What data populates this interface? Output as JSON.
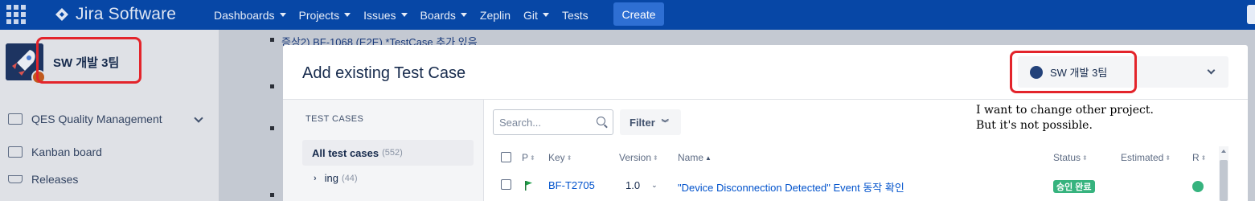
{
  "nav": {
    "logo_text": "Jira Software",
    "items": [
      {
        "label": "Dashboards",
        "has_caret": true
      },
      {
        "label": "Projects",
        "has_caret": true
      },
      {
        "label": "Issues",
        "has_caret": true
      },
      {
        "label": "Boards",
        "has_caret": true
      },
      {
        "label": "Zeplin",
        "has_caret": false
      },
      {
        "label": "Git",
        "has_caret": true
      },
      {
        "label": "Tests",
        "has_caret": false
      }
    ],
    "create_label": "Create",
    "bg_color": "#0747a6"
  },
  "sidebar": {
    "project_name": "SW 개발 3팀",
    "items": [
      {
        "label": "QES Quality Management",
        "icon": "book-icon"
      },
      {
        "label": "Kanban board",
        "icon": "board-icon"
      },
      {
        "label": "Releases",
        "icon": "ship-icon"
      }
    ]
  },
  "background": {
    "line_text": "증상2) BF-1068 (E2E) *TestCase 추가 있음"
  },
  "modal": {
    "title": "Add existing Test Case",
    "project_select": {
      "label": "SW 개발 3팀"
    },
    "left_pane": {
      "heading": "TEST CASES",
      "all_label": "All test cases",
      "all_count": "(552)",
      "folder_label": "ing",
      "folder_count": "(44)"
    },
    "search_placeholder": "Search...",
    "filter_label": "Filter",
    "note_line1": "I want to change other project.",
    "note_line2": "But it's not possible.",
    "columns": {
      "p": "P",
      "key": "Key",
      "version": "Version",
      "name": "Name",
      "status": "Status",
      "estimated": "Estimated",
      "r": "R"
    },
    "row": {
      "key": "BF-T2705",
      "version": "1.0",
      "name": "\"Device Disconnection Detected\" Event 동작 확인",
      "status": "승인 완료",
      "status_color": "#36b37e"
    }
  },
  "annotation_color": "#e3242b"
}
